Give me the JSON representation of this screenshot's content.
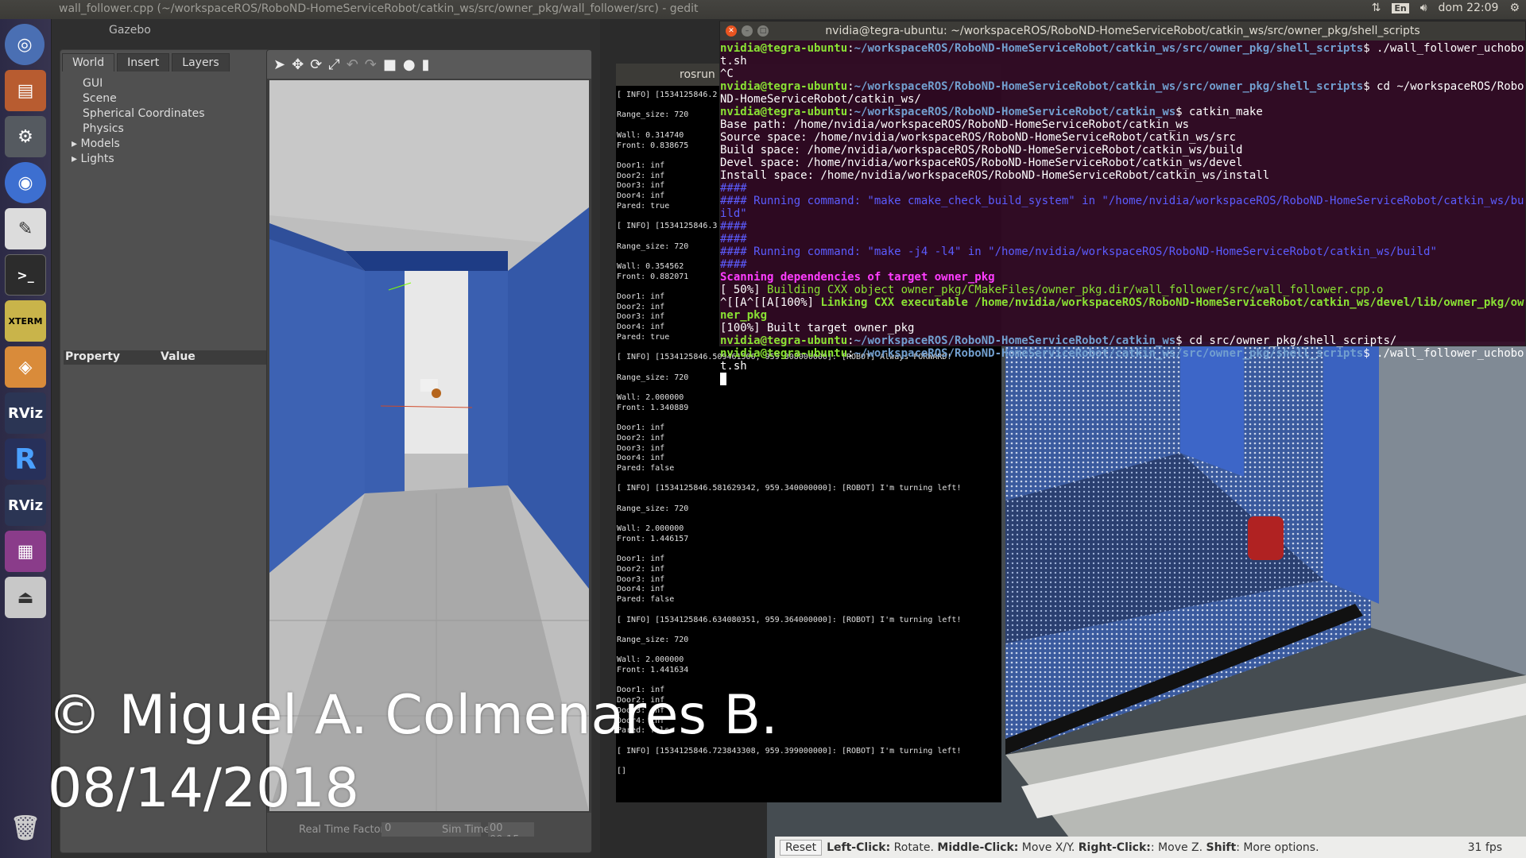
{
  "topbar": {
    "window_title": "wall_follower.cpp (~/workspaceROS/RoboND-HomeServiceRobot/catkin_ws/src/owner_pkg/wall_follower/src) - gedit",
    "lang": "En",
    "clock": "dom 22:09"
  },
  "gazebo": {
    "title": "Gazebo",
    "tabs": [
      "World",
      "Insert",
      "Layers"
    ],
    "tree": [
      "GUI",
      "Scene",
      "Spherical Coordinates",
      "Physics",
      "Models",
      "Lights"
    ],
    "prop_header": "Property",
    "value_header": "Value",
    "real_time_label": "Real Time Factor:",
    "real_time_value": "0",
    "sim_time_label": "Sim Time:",
    "sim_time_value": "00 00:15::"
  },
  "rosrun": {
    "title": "rosrun",
    "log": "[ INFO] [1534125846.2\n\nRange_size: 720\n\nWall: 0.314740\nFront: 0.838675\n\nDoor1: inf\nDoor2: inf\nDoor3: inf\nDoor4: inf\nPared: true\n\n[ INFO] [1534125846.3\n\nRange_size: 720\n\nWall: 0.354562\nFront: 0.882071\n\nDoor1: inf\nDoor2: inf\nDoor3: inf\nDoor4: inf\nPared: true\n\n[ INFO] [1534125846.509461500, 959.308000000]: [ROBOT] Always FORWARD!\n\nRange_size: 720\n\nWall: 2.000000\nFront: 1.340889\n\nDoor1: inf\nDoor2: inf\nDoor3: inf\nDoor4: inf\nPared: false\n\n[ INFO] [1534125846.581629342, 959.340000000]: [ROBOT] I'm turning left!\n\nRange_size: 720\n\nWall: 2.000000\nFront: 1.446157\n\nDoor1: inf\nDoor2: inf\nDoor3: inf\nDoor4: inf\nPared: false\n\n[ INFO] [1534125846.634080351, 959.364000000]: [ROBOT] I'm turning left!\n\nRange_size: 720\n\nWall: 2.000000\nFront: 1.441634\n\nDoor1: inf\nDoor2: inf\nDoor3: inf\nDoor4: inf\nPared: false\n\n[ INFO] [1534125846.723843308, 959.399000000]: [ROBOT] I'm turning left!\n\n[]"
  },
  "terminal": {
    "title": "nvidia@tegra-ubuntu: ~/workspaceROS/RoboND-HomeServiceRobot/catkin_ws/src/owner_pkg/shell_scripts",
    "user": "nvidia@tegra-ubuntu",
    "path_scripts": "~/workspaceROS/RoboND-HomeServiceRobot/catkin_ws/src/owner_pkg/shell_scripts",
    "path_ws": "~/workspaceROS/RoboND-HomeServiceRobot/catkin_ws",
    "cmd1": "$ ./wall_follower_uchobot.sh",
    "ctrlc": "^C",
    "cmd2": "$ cd ~/workspaceROS/RoboND-HomeServiceRobot/catkin_ws/",
    "cmd3": "$ catkin_make",
    "base": "Base path: /home/nvidia/workspaceROS/RoboND-HomeServiceRobot/catkin_ws",
    "source": "Source space: /home/nvidia/workspaceROS/RoboND-HomeServiceRobot/catkin_ws/src",
    "build": "Build space: /home/nvidia/workspaceROS/RoboND-HomeServiceRobot/catkin_ws/build",
    "devel": "Devel space: /home/nvidia/workspaceROS/RoboND-HomeServiceRobot/catkin_ws/devel",
    "install": "Install space: /home/nvidia/workspaceROS/RoboND-HomeServiceRobot/catkin_ws/install",
    "hash": "####",
    "run1": "#### Running command: \"make cmake_check_build_system\" in \"/home/nvidia/workspaceROS/RoboND-HomeServiceRobot/catkin_ws/build\"",
    "run2": "#### Running command: \"make -j4 -l4\" in \"/home/nvidia/workspaceROS/RoboND-HomeServiceRobot/catkin_ws/build\"",
    "scan": "Scanning dependencies of target owner_pkg",
    "pct50": "[ 50%] ",
    "building": "Building CXX object owner_pkg/CMakeFiles/owner_pkg.dir/wall_follower/src/wall_follower.cpp.o",
    "linkpre": "^[[A^[[A[100%] ",
    "linking": "Linking CXX executable /home/nvidia/workspaceROS/RoboND-HomeServiceRobot/catkin_ws/devel/lib/owner_pkg/owner_pkg",
    "built": "[100%] Built target owner_pkg",
    "cmd4": "$ cd src/owner_pkg/shell_scripts/",
    "cmd5": "$ ./wall_follower_uchobot.sh"
  },
  "rviz": {
    "reset": "Reset",
    "help_left_b": "Left-Click:",
    "help_left": " Rotate. ",
    "help_mid_b": "Middle-Click:",
    "help_mid": " Move X/Y. ",
    "help_right_b": "Right-Click:",
    "help_right": ": Move Z. ",
    "help_shift_b": "Shift",
    "help_shift": ": More options.",
    "fps": "31 fps"
  },
  "watermark": {
    "line1": "© Miguel A. Colmenares B.",
    "line2": "08/14/2018"
  },
  "launcher_icons": [
    "ubuntu-icon",
    "files-icon",
    "settings-icon",
    "chromium-icon",
    "text-editor-icon",
    "terminal-icon",
    "xterm-icon",
    "package-icon",
    "rviz-icon",
    "ros-r-icon",
    "rviz-icon-2",
    "workspace-icon",
    "usb-drive-icon",
    "trash-icon"
  ]
}
